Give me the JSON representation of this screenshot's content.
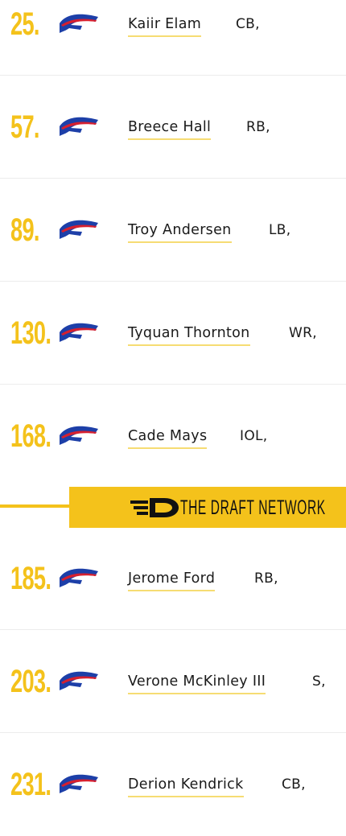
{
  "picks": [
    {
      "number": "25.",
      "player": "Kaiir Elam",
      "position": "CB,"
    },
    {
      "number": "57.",
      "player": "Breece Hall",
      "position": "RB,"
    },
    {
      "number": "89.",
      "player": "Troy Andersen",
      "position": "LB,"
    },
    {
      "number": "130.",
      "player": "Tyquan Thornton",
      "position": "WR,"
    },
    {
      "number": "168.",
      "player": "Cade Mays",
      "position": "IOL,"
    },
    {
      "number": "185.",
      "player": "Jerome Ford",
      "position": "RB,"
    },
    {
      "number": "203.",
      "player": "Verone McKinley III",
      "position": "S,"
    },
    {
      "number": "231.",
      "player": "Derion Kendrick",
      "position": "CB,"
    }
  ],
  "banner": {
    "text": "THE DRAFT NETWORK"
  },
  "colors": {
    "gold": "#f4c21b",
    "bills_blue": "#1d3fa8",
    "bills_red": "#d6202f"
  },
  "icons": {
    "team_logo": "bills-logo-icon",
    "network_logo": "draft-network-logo-icon"
  }
}
